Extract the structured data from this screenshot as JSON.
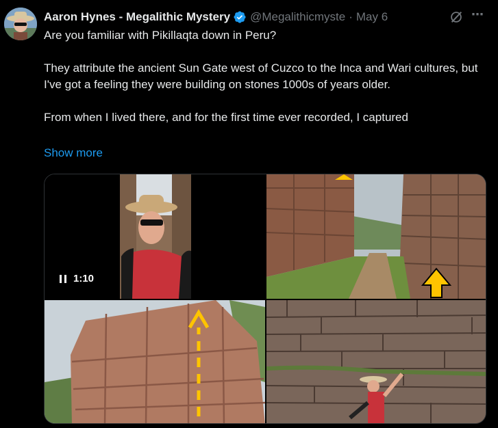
{
  "tweet": {
    "author_name": "Aaron Hynes - Megalithic Mystery",
    "handle": "@Megalithicmyste",
    "separator": "·",
    "date": "May 6",
    "paragraphs": [
      "Are you familiar with Pikillaqta down in Peru?",
      "They attribute the ancient Sun Gate west of Cuzco to the Inca and Wari cultures, but I've got a feeling they were building on stones 1000s of years older.",
      "From when I lived there, and for the first time ever recorded, I captured"
    ],
    "show_more": "Show more",
    "more_icon": "⋯"
  },
  "video": {
    "time": "1:10"
  },
  "colors": {
    "background": "#000000",
    "text": "#e7e9ea",
    "secondary": "#71767b",
    "link": "#1d9bf0",
    "verified": "#1d9bf0"
  },
  "icons": [
    "avatar",
    "verified-badge-icon",
    "grok-icon",
    "more-icon",
    "pause-icon"
  ]
}
